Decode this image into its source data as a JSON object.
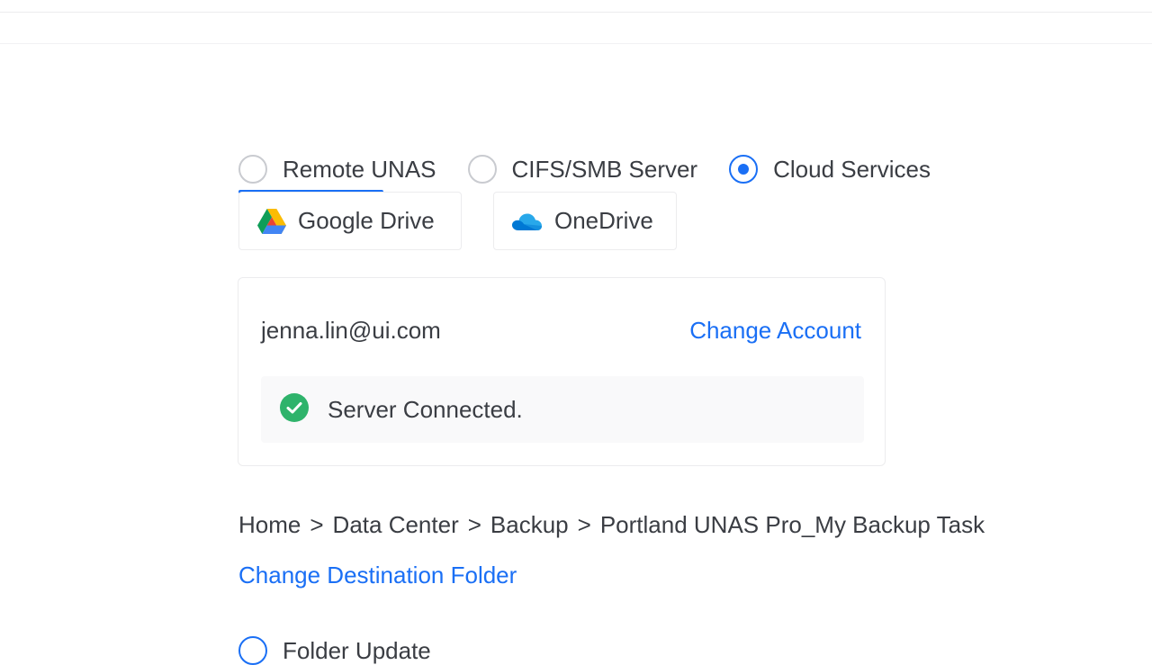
{
  "destination_types": [
    {
      "label": "Remote UNAS",
      "selected": false
    },
    {
      "label": "CIFS/SMB Server",
      "selected": false
    },
    {
      "label": "Cloud Services",
      "selected": true
    }
  ],
  "cloud_providers": [
    {
      "label": "Google Drive",
      "icon": "google-drive-icon"
    },
    {
      "label": "OneDrive",
      "icon": "onedrive-icon"
    }
  ],
  "account": {
    "email": "jenna.lin@ui.com",
    "change_label": "Change Account",
    "status_text": "Server Connected.",
    "status_icon": "check-circle-icon",
    "status_color": "#2fb36b"
  },
  "breadcrumb": {
    "items": [
      "Home",
      "Data Center",
      "Backup",
      "Portland UNAS Pro_My Backup Task"
    ],
    "separator": ">"
  },
  "change_folder_label": "Change Destination Folder",
  "next_option_label": "Folder Update",
  "colors": {
    "accent": "#1a6ff5",
    "text": "#3a3d43",
    "border": "#ececee"
  }
}
